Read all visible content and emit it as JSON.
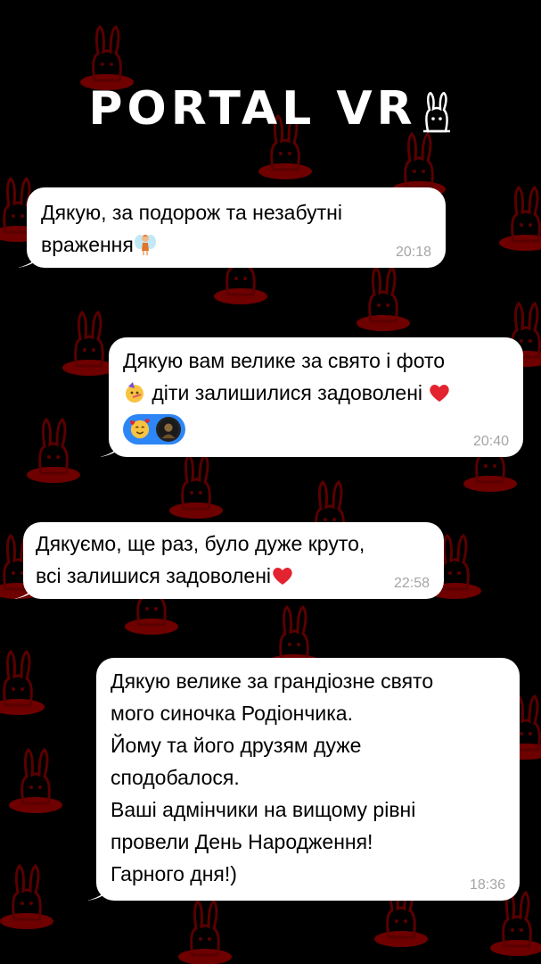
{
  "brand": {
    "name": "PORTAL VR"
  },
  "colors": {
    "background": "#000000",
    "bunny": "#6e0000",
    "bubble": "#ffffff",
    "time": "#a5a5a5",
    "reaction": "#2d86f5"
  },
  "messages": [
    {
      "side": "in",
      "text": "Дякую, за подорож та незабутні\nвраження",
      "emoji": "fairy-icon",
      "time": "20:18"
    },
    {
      "side": "out",
      "text_line1": "Дякую вам велике за свято і фото",
      "text_line2": "діти залишилися задоволені",
      "emoji_start": "party-face-icon",
      "emoji_end": "red-heart-icon",
      "reactions": [
        "smiling-face-with-hearts-icon",
        "user-avatar"
      ],
      "time": "20:40"
    },
    {
      "side": "in",
      "text": "Дякуємо, ще раз, було дуже круто,\nвсі залишися задоволені",
      "emoji": "red-heart-icon",
      "time": "22:58"
    },
    {
      "side": "out",
      "text": "Дякую велике за грандіозне свято\nмого синочка Родіончика.\nЙому та його друзям дуже\nсподобалося.\nВаші адмінчики на вищому рівні\nпровели День Народження!\nГарного дня!)",
      "time": "18:36"
    }
  ]
}
